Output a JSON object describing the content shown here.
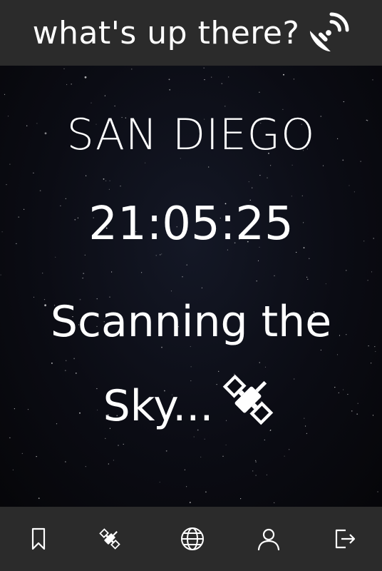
{
  "header": {
    "title": "what's up there?",
    "icon": "satellite-dish-icon"
  },
  "main": {
    "city": "SAN DIEGO",
    "clock": "21:05:25",
    "status_line1": "Scanning the",
    "status_line2": "Sky...",
    "status_icon": "satellite-icon"
  },
  "nav": {
    "items": [
      {
        "icon": "bookmark-icon"
      },
      {
        "icon": "satellite-icon"
      },
      {
        "icon": "globe-icon"
      },
      {
        "icon": "user-icon"
      },
      {
        "icon": "logout-icon"
      }
    ]
  },
  "colors": {
    "bar": "#2b2b2b",
    "sky": "#0b0c14",
    "text": "#ffffff"
  }
}
